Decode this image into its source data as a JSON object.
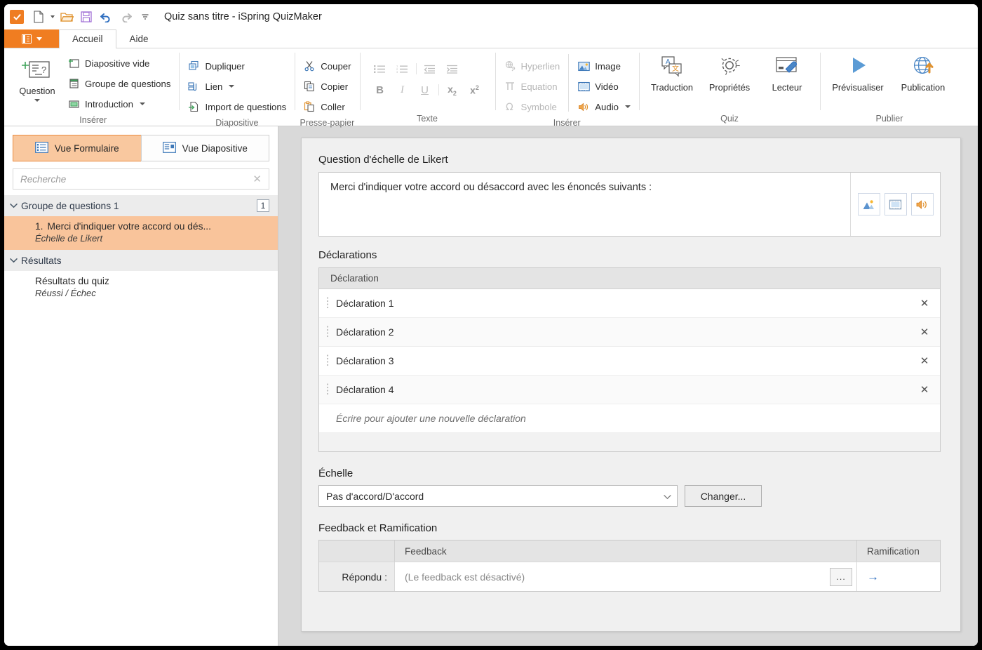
{
  "window": {
    "title": "Quiz sans titre - iSpring QuizMaker",
    "app_accent": "#f07d21"
  },
  "quick_access": {
    "app_icon": "checkbox-orange-icon",
    "buttons": [
      {
        "name": "new-file",
        "icon": "new-file-icon",
        "has_caret": true
      },
      {
        "name": "open-file",
        "icon": "open-folder-icon",
        "has_caret": false
      },
      {
        "name": "save-file",
        "icon": "floppy-save-icon",
        "has_caret": false
      },
      {
        "name": "undo",
        "icon": "undo-arrow-icon",
        "has_caret": false
      },
      {
        "name": "redo",
        "icon": "redo-arrow-icon",
        "has_caret": false
      },
      {
        "name": "customize-qat",
        "icon": "chevron-down-icon",
        "has_caret": false
      }
    ]
  },
  "tabs": {
    "file_menu_label": "",
    "items": [
      {
        "label": "Accueil",
        "active": true
      },
      {
        "label": "Aide",
        "active": false
      }
    ]
  },
  "ribbon": {
    "groups": [
      {
        "name": "inserer",
        "label": "Insérer",
        "big": {
          "label": "Question",
          "icon": "question-slide-icon",
          "has_dropdown": true
        },
        "items": [
          {
            "label": "Diapositive vide",
            "icon": "blank-slide-icon",
            "dropdown": false,
            "disabled": false
          },
          {
            "label": "Groupe de questions",
            "icon": "question-group-icon",
            "dropdown": false,
            "disabled": false
          },
          {
            "label": "Introduction",
            "icon": "introduction-slide-icon",
            "dropdown": true,
            "disabled": false
          }
        ]
      },
      {
        "name": "diapositive",
        "label": "Diapositive",
        "items": [
          {
            "label": "Dupliquer",
            "icon": "duplicate-icon",
            "dropdown": false,
            "disabled": false
          },
          {
            "label": "Lien",
            "icon": "link-icon",
            "dropdown": true,
            "disabled": false
          },
          {
            "label": "Import de questions",
            "icon": "import-questions-icon",
            "dropdown": false,
            "disabled": false
          }
        ]
      },
      {
        "name": "presse-papier",
        "label": "Presse-papier",
        "items": [
          {
            "label": "Couper",
            "icon": "scissors-icon",
            "dropdown": false,
            "disabled": false
          },
          {
            "label": "Copier",
            "icon": "copy-icon",
            "dropdown": false,
            "disabled": false
          },
          {
            "label": "Coller",
            "icon": "paste-icon",
            "dropdown": false,
            "disabled": false
          }
        ]
      },
      {
        "name": "texte",
        "label": "Texte",
        "row1": [
          {
            "name": "bullet-list-icon",
            "glyph": "bullets",
            "disabled": true
          },
          {
            "name": "numbered-list-icon",
            "glyph": "numbers",
            "disabled": true
          },
          {
            "name": "decrease-indent-icon",
            "glyph": "outdent",
            "disabled": true
          },
          {
            "name": "increase-indent-icon",
            "glyph": "indent",
            "disabled": true
          }
        ],
        "row2": [
          {
            "name": "bold-icon",
            "label": "B",
            "disabled": true
          },
          {
            "name": "italic-icon",
            "label": "I",
            "disabled": true
          },
          {
            "name": "underline-icon",
            "label": "U",
            "disabled": true
          },
          {
            "name": "subscript-icon",
            "label": "x₂",
            "disabled": true
          },
          {
            "name": "superscript-icon",
            "label": "x²",
            "disabled": true
          }
        ]
      },
      {
        "name": "inserer-media",
        "label": "Insérer",
        "colA": [
          {
            "label": "Hyperlien",
            "icon": "hyperlink-icon",
            "dropdown": false,
            "disabled": true
          },
          {
            "label": "Equation",
            "icon": "equation-icon",
            "dropdown": false,
            "disabled": true
          },
          {
            "label": "Symbole",
            "icon": "symbol-omega-icon",
            "dropdown": false,
            "disabled": true
          }
        ],
        "colB": [
          {
            "label": "Image",
            "icon": "image-icon",
            "dropdown": false,
            "disabled": false
          },
          {
            "label": "Vidéo",
            "icon": "video-icon",
            "dropdown": false,
            "disabled": false
          },
          {
            "label": "Audio",
            "icon": "audio-speaker-icon",
            "dropdown": true,
            "disabled": false
          }
        ]
      },
      {
        "name": "quiz",
        "label": "Quiz",
        "big_items": [
          {
            "label": "Traduction",
            "icon": "translation-icon",
            "has_dropdown": true
          },
          {
            "label": "Propriétés",
            "icon": "gear-icon",
            "has_dropdown": false
          },
          {
            "label": "Lecteur",
            "icon": "player-wrench-icon",
            "has_dropdown": false
          }
        ]
      },
      {
        "name": "publier",
        "label": "Publier",
        "big_items": [
          {
            "label": "Prévisualiser",
            "icon": "play-triangle-icon",
            "has_dropdown": true
          },
          {
            "label": "Publication",
            "icon": "globe-upload-icon",
            "has_dropdown": false
          }
        ]
      }
    ]
  },
  "sidebar": {
    "view_tabs": [
      {
        "label": "Vue Formulaire",
        "icon": "form-view-icon",
        "active": true
      },
      {
        "label": "Vue Diapositive",
        "icon": "slide-view-icon",
        "active": false
      }
    ],
    "search": {
      "placeholder": "Recherche",
      "value": "",
      "clear_icon": "close-icon"
    },
    "tree": [
      {
        "type": "group",
        "label": "Groupe de questions 1",
        "badge": "1",
        "expanded": true,
        "children": [
          {
            "number": "1.",
            "title": "Merci d'indiquer votre accord ou dés...",
            "subtitle": "Échelle de Likert",
            "selected": true
          }
        ]
      },
      {
        "type": "group",
        "label": "Résultats",
        "badge": "",
        "expanded": true,
        "children": [
          {
            "number": "",
            "title": "Résultats du quiz",
            "subtitle": "Réussi / Échec",
            "selected": false
          }
        ]
      }
    ]
  },
  "main": {
    "question_type_title": "Question d'échelle de Likert",
    "question_text": "Merci d'indiquer votre accord ou désaccord avec les énoncés suivants :",
    "media_buttons": [
      {
        "name": "insert-image-button",
        "icon": "image-icon"
      },
      {
        "name": "insert-video-button",
        "icon": "video-icon"
      },
      {
        "name": "insert-audio-button",
        "icon": "audio-speaker-icon"
      }
    ],
    "statements_title": "Déclarations",
    "statements_header": "Déclaration",
    "statements": [
      {
        "text": "Déclaration 1"
      },
      {
        "text": "Déclaration 2"
      },
      {
        "text": "Déclaration 3"
      },
      {
        "text": "Déclaration 4"
      }
    ],
    "statements_new_placeholder": "Écrire pour ajouter une nouvelle déclaration",
    "remove_icon": "close-icon",
    "grip_icon": "drag-handle-icon",
    "scale_label": "Échelle",
    "scale_value": "Pas d'accord/D'accord",
    "scale_change_button": "Changer...",
    "feedback_title": "Feedback et Ramification",
    "feedback_columns": {
      "first": "",
      "feedback": "Feedback",
      "branching": "Ramification"
    },
    "feedback_rows": [
      {
        "label": "Répondu :",
        "value": "(Le feedback est désactivé)",
        "ellipsis": "...",
        "branch_icon": "arrow-right-icon"
      }
    ]
  }
}
